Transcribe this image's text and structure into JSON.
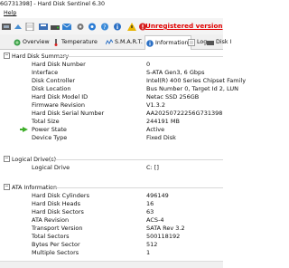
{
  "window": {
    "title": "6G731398] - Hard Disk Sentinel 6.30"
  },
  "menu": {
    "help": "Help"
  },
  "toolbar": {
    "unregistered": "Unregistered version"
  },
  "tabs": [
    {
      "label": "Overview",
      "icon": "globe-icon"
    },
    {
      "label": "Temperature",
      "icon": "thermometer-icon"
    },
    {
      "label": "S.M.A.R.T.",
      "icon": "smart-icon"
    },
    {
      "label": "Information",
      "icon": "info-icon"
    },
    {
      "label": "Log",
      "icon": "log-icon"
    },
    {
      "label": "Disk I",
      "icon": "disk-icon"
    }
  ],
  "sections": {
    "hard_disk_summary": "Hard Disk Summary",
    "logical_drives": "Logical Drive(s)",
    "ata_information": "ATA Information"
  },
  "summary_rows": [
    {
      "label": "Hard Disk Number",
      "value": "0"
    },
    {
      "label": "Interface",
      "value": "S-ATA Gen3, 6 Gbps"
    },
    {
      "label": "Disk Controller",
      "value": "Intel(R) 400 Series Chipset Family"
    },
    {
      "label": "Disk Location",
      "value": "Bus Number 0, Target Id 2, LUN"
    },
    {
      "label": "Hard Disk Model ID",
      "value": "Netac SSD 256GB"
    },
    {
      "label": "Firmware Revision",
      "value": "V1.3.2"
    },
    {
      "label": "Hard Disk Serial Number",
      "value": "AA20250722256G731398"
    },
    {
      "label": "Total Size",
      "value": "244191 MB"
    },
    {
      "label": "Power State",
      "value": "Active"
    },
    {
      "label": "Device Type",
      "value": "Fixed Disk"
    }
  ],
  "logical_rows": [
    {
      "label": "Logical Drive",
      "value": "C: []"
    }
  ],
  "ata_rows": [
    {
      "label": "Hard Disk Cylinders",
      "value": "496149"
    },
    {
      "label": "Hard Disk Heads",
      "value": "16"
    },
    {
      "label": "Hard Disk Sectors",
      "value": "63"
    },
    {
      "label": "ATA Revision",
      "value": "ACS-4"
    },
    {
      "label": "Transport Version",
      "value": "SATA Rev 3.2"
    },
    {
      "label": "Total Sectors",
      "value": "500118192"
    },
    {
      "label": "Bytes Per Sector",
      "value": "512"
    },
    {
      "label": "Multiple Sectors",
      "value": "1"
    }
  ]
}
